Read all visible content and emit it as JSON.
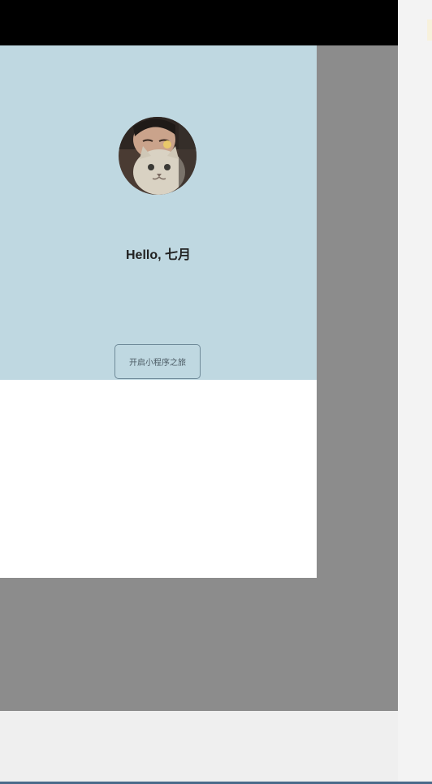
{
  "window": {
    "title_bar_color": "#000000"
  },
  "simulator": {
    "background_color": "#8c8c8c"
  },
  "app": {
    "hero_color": "#bfd8e1",
    "avatar": {
      "icon": "user-avatar-cat-photo"
    },
    "greeting": "Hello, 七月",
    "start_button_label": "开启小程序之旅"
  }
}
